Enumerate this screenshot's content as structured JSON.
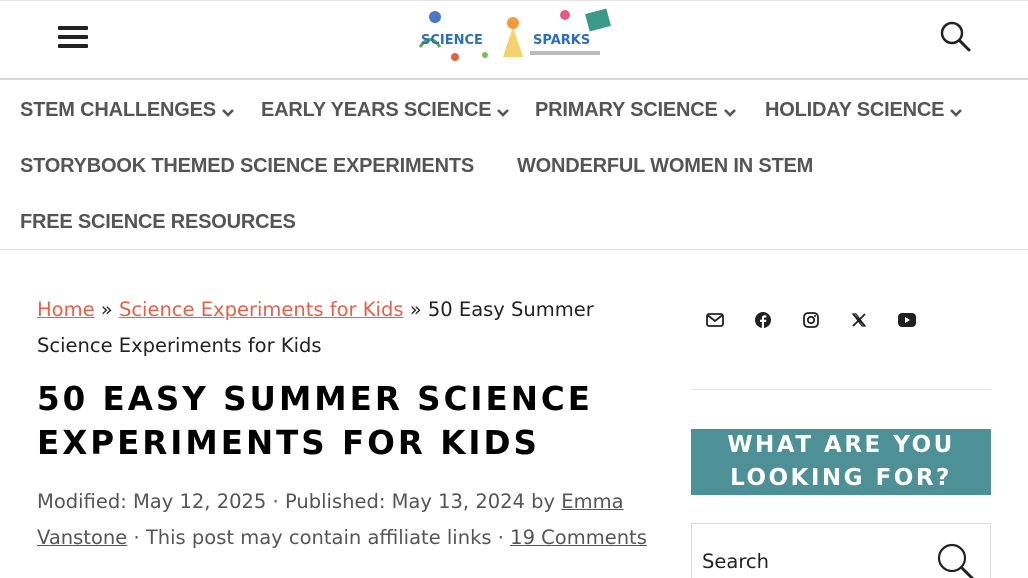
{
  "header": {
    "menu_icon": "hamburger-menu-icon",
    "logo_alt": "Science Sparks",
    "logo_word_1": "SCIENCE",
    "logo_word_2": "SPARKS",
    "search_icon": "search-icon"
  },
  "nav": {
    "items": [
      {
        "label": "STEM CHALLENGES",
        "has_dropdown": true
      },
      {
        "label": "EARLY YEARS SCIENCE",
        "has_dropdown": true
      },
      {
        "label": "PRIMARY SCIENCE",
        "has_dropdown": true
      },
      {
        "label": "HOLIDAY SCIENCE",
        "has_dropdown": true
      },
      {
        "label": "STORYBOOK THEMED SCIENCE EXPERIMENTS",
        "has_dropdown": false
      },
      {
        "label": "WONDERFUL WOMEN IN STEM",
        "has_dropdown": false
      },
      {
        "label": "FREE SCIENCE RESOURCES",
        "has_dropdown": false
      }
    ]
  },
  "breadcrumb": {
    "home": "Home",
    "separator": "»",
    "category": "Science Experiments for Kids",
    "current": "50 Easy Summer Science Experiments for Kids"
  },
  "article": {
    "title": "50 EASY SUMMER SCIENCE EXPERIMENTS FOR KIDS",
    "modified_label": "Modified:",
    "modified_date": "May 12, 2025",
    "dot": "·",
    "published_label": "Published:",
    "published_date": "May 13, 2024",
    "by_label": "by",
    "author": "Emma Vanstone",
    "affiliate_note": "This post may contain affiliate links",
    "comments": "19 Comments"
  },
  "sidebar": {
    "socials": [
      {
        "name": "email-icon"
      },
      {
        "name": "facebook-icon"
      },
      {
        "name": "instagram-icon"
      },
      {
        "name": "x-twitter-icon"
      },
      {
        "name": "youtube-icon"
      }
    ],
    "widget_title": "WHAT ARE YOU LOOKING FOR?",
    "search_placeholder": "Search"
  },
  "colors": {
    "link_accent": "#e0624a",
    "widget_bg": "#4d9196",
    "nav_text": "#555555"
  }
}
